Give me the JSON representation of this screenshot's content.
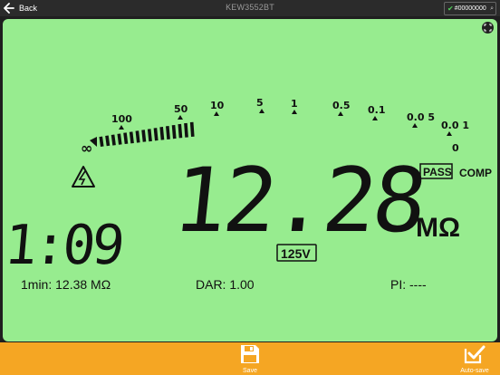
{
  "header": {
    "back_label": "Back",
    "title": "KEW3552BT",
    "id_value": "#00000000"
  },
  "meter": {
    "scale_labels": [
      "100",
      "50",
      "10",
      "5",
      "1",
      "0.5",
      "0.1",
      "0.0 5",
      "0.0 1",
      "0"
    ],
    "reading": "12.28",
    "unit": "MΩ",
    "pass_label": "PASS",
    "comp_label": "COMP",
    "timer": "1:09",
    "voltage": "125V",
    "one_min_label": "1min: 12.38 MΩ",
    "dar_label": "DAR:  1.00",
    "pi_label": "PI: ----"
  },
  "footer": {
    "save_label": "Save",
    "autosave_label": "Auto-save"
  }
}
